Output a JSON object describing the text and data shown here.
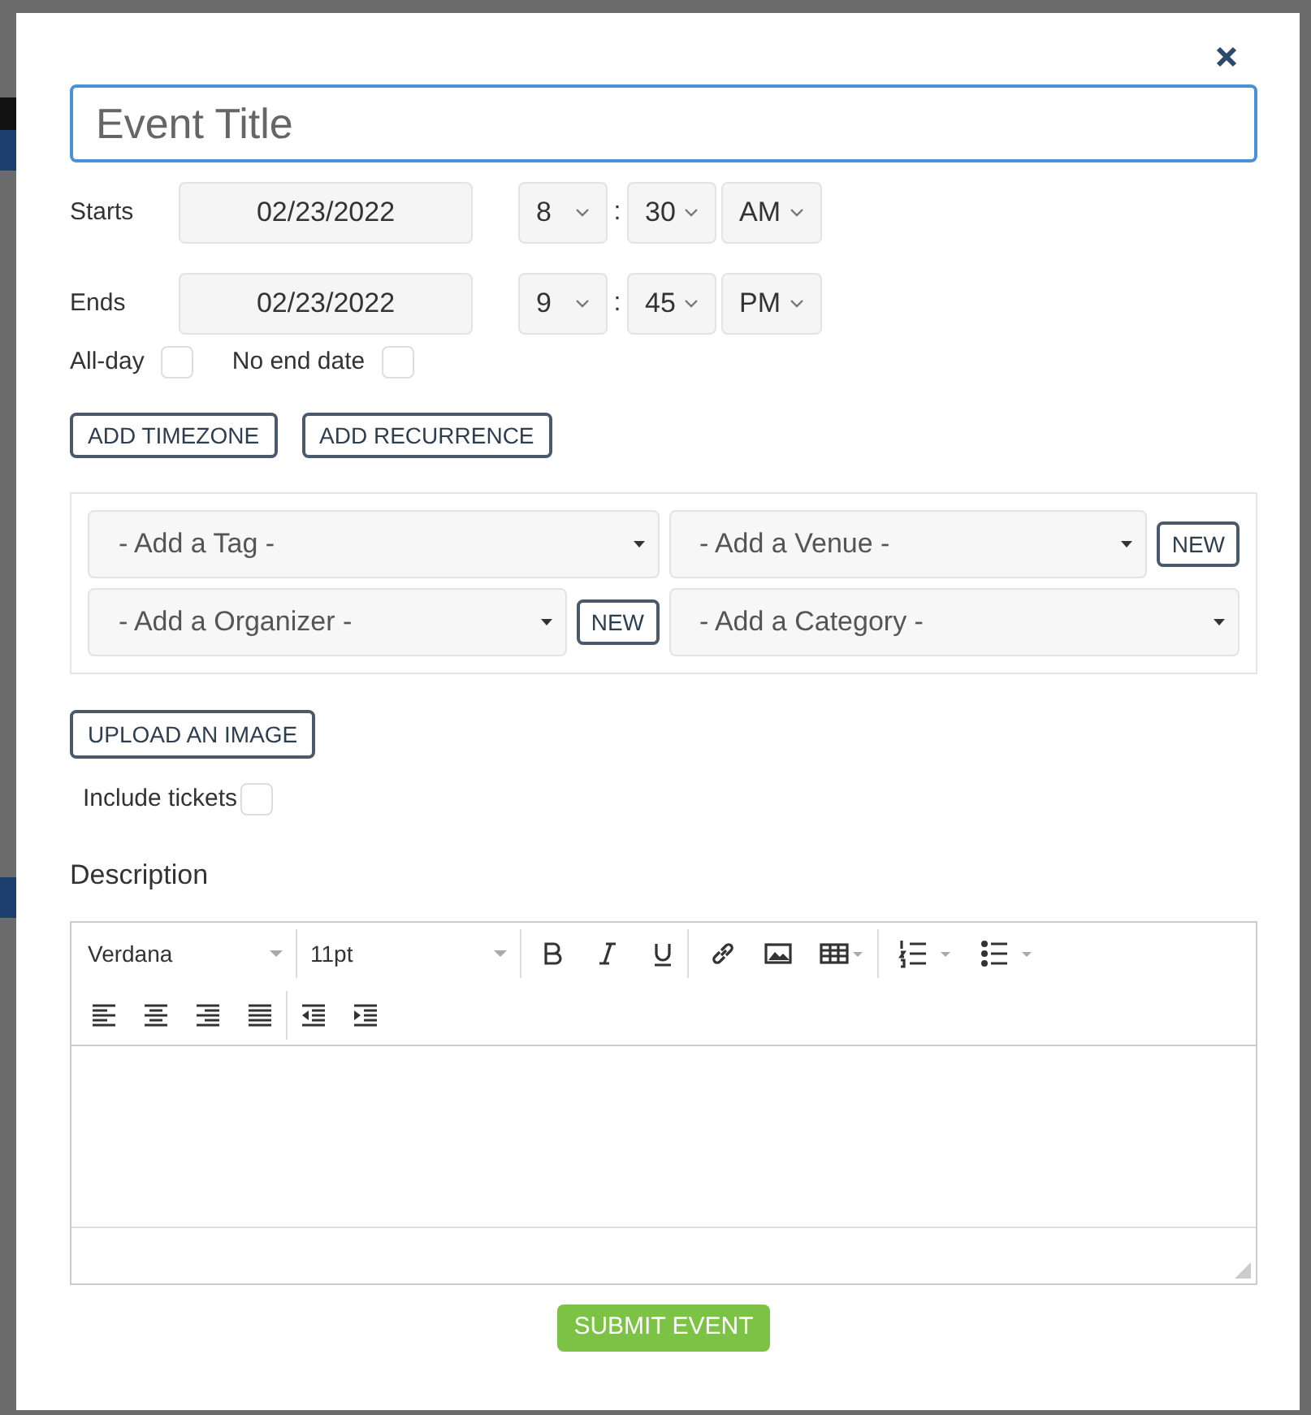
{
  "title_field": {
    "placeholder": "Event Title"
  },
  "date_rows": [
    {
      "label": "Starts",
      "date": "02/23/2022",
      "hour": "8",
      "separator": ":",
      "minute": "30",
      "ampm": "AM"
    },
    {
      "label": "Ends",
      "date": "02/23/2022",
      "hour": "9",
      "separator": ":",
      "minute": "45",
      "ampm": "PM"
    }
  ],
  "checkboxes": [
    {
      "label": "All-day",
      "checked": false
    },
    {
      "label": "No end date",
      "checked": false
    }
  ],
  "option_buttons": [
    "ADD TIMEZONE",
    "ADD RECURRENCE"
  ],
  "pickers": [
    {
      "placeholder": "- Add a Tag -"
    },
    {
      "placeholder": "- Add a Venue -",
      "new_button": "NEW"
    },
    {
      "placeholder": "- Add a Organizer -",
      "new_button": "NEW"
    },
    {
      "placeholder": "- Add a Category -"
    }
  ],
  "upload_button": "UPLOAD AN IMAGE",
  "tickets": {
    "label": "Include tickets",
    "checked": false
  },
  "description": {
    "label": "Description",
    "font": "Verdana",
    "size": "11pt"
  },
  "submit_button": "SUBMIT EVENT"
}
